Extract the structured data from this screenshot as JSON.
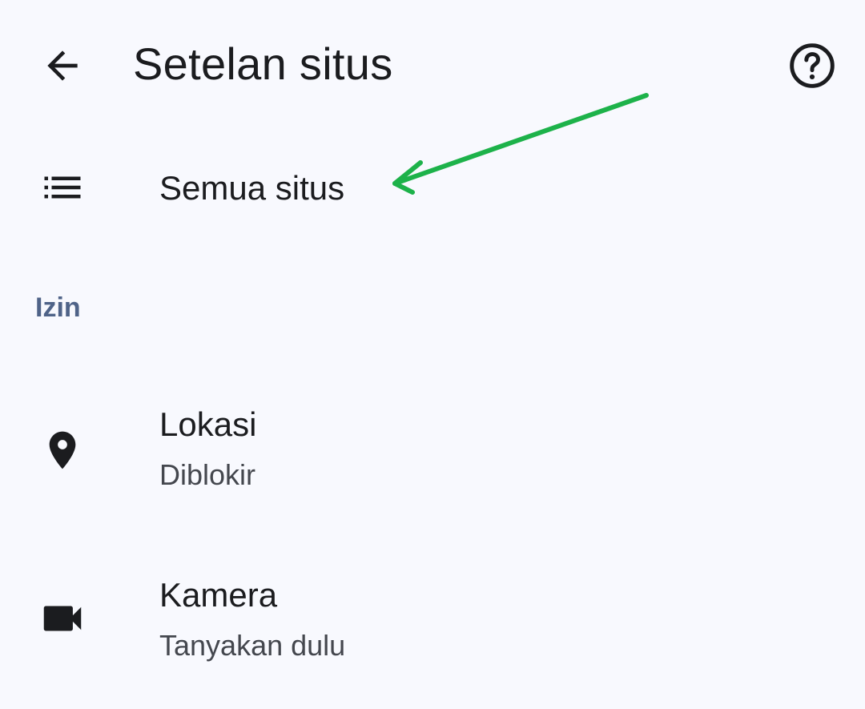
{
  "app_bar": {
    "title": "Setelan situs",
    "back_icon": "arrow-back-icon",
    "help_icon": "help-circle-icon"
  },
  "rows": {
    "all_sites": {
      "title": "Semua situs",
      "icon": "list-icon"
    },
    "location": {
      "title": "Lokasi",
      "subtitle": "Diblokir",
      "icon": "location-pin-icon"
    },
    "camera": {
      "title": "Kamera",
      "subtitle": "Tanyakan dulu",
      "icon": "videocam-icon"
    }
  },
  "sections": {
    "permissions_header": "Izin"
  },
  "annotation": {
    "type": "arrow",
    "color": "#1db24a",
    "points_to": "Semua situs"
  },
  "colors": {
    "background": "#f8f9fe",
    "text_primary": "#1b1c1f",
    "text_secondary": "#44474e",
    "section_header": "#4f6388",
    "annotation": "#1db24a"
  }
}
